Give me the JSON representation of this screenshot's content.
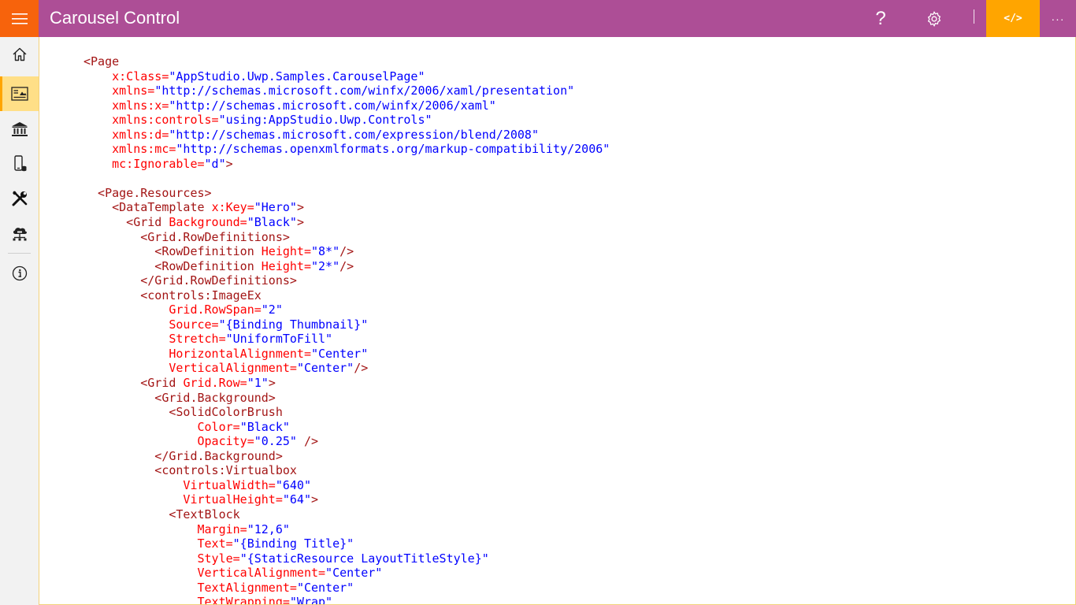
{
  "app": {
    "title": "Carousel Control"
  },
  "titlebar": {
    "menu_icon": "hamburger-icon",
    "help_label": "?",
    "settings_icon": "gear-icon",
    "code_button_label": "</>",
    "more_label": "···",
    "colors": {
      "bar": "#ad4e96",
      "hamburger": "#f7630c",
      "code_button": "#ffa500"
    }
  },
  "sidebar": {
    "items": [
      {
        "icon": "home-icon",
        "selected": false
      },
      {
        "icon": "gallery-icon",
        "selected": true
      },
      {
        "icon": "bank-icon",
        "selected": false
      },
      {
        "icon": "mobile-device-icon",
        "selected": false
      },
      {
        "icon": "tools-icon",
        "selected": false
      },
      {
        "icon": "cloud-network-icon",
        "selected": false
      },
      {
        "icon": "info-icon",
        "selected": false
      }
    ],
    "colors": {
      "background": "#f2f2f2",
      "selected": "#ffdf87"
    }
  },
  "code": {
    "language": "XAML",
    "colors": {
      "tag": "#a31515",
      "attribute": "#ff0000",
      "value": "#0000ff"
    },
    "lines": [
      [
        {
          "k": "tag",
          "t": "<Page"
        }
      ],
      [
        {
          "k": "attr",
          "t": "    x:Class="
        },
        {
          "k": "val",
          "t": "\"AppStudio.Uwp.Samples.CarouselPage\""
        }
      ],
      [
        {
          "k": "attr",
          "t": "    xmlns="
        },
        {
          "k": "val",
          "t": "\"http://schemas.microsoft.com/winfx/2006/xaml/presentation\""
        }
      ],
      [
        {
          "k": "attr",
          "t": "    xmlns:x="
        },
        {
          "k": "val",
          "t": "\"http://schemas.microsoft.com/winfx/2006/xaml\""
        }
      ],
      [
        {
          "k": "attr",
          "t": "    xmlns:controls="
        },
        {
          "k": "val",
          "t": "\"using:AppStudio.Uwp.Controls\""
        }
      ],
      [
        {
          "k": "attr",
          "t": "    xmlns:d="
        },
        {
          "k": "val",
          "t": "\"http://schemas.microsoft.com/expression/blend/2008\""
        }
      ],
      [
        {
          "k": "attr",
          "t": "    xmlns:mc="
        },
        {
          "k": "val",
          "t": "\"http://schemas.openxmlformats.org/markup-compatibility/2006\""
        }
      ],
      [
        {
          "k": "attr",
          "t": "    mc:Ignorable="
        },
        {
          "k": "val",
          "t": "\"d\""
        },
        {
          "k": "tag",
          "t": ">"
        }
      ],
      [],
      [
        {
          "k": "tag",
          "t": "  <Page.Resources>"
        }
      ],
      [
        {
          "k": "tag",
          "t": "    <DataTemplate "
        },
        {
          "k": "attr",
          "t": "x:Key="
        },
        {
          "k": "val",
          "t": "\"Hero\""
        },
        {
          "k": "tag",
          "t": ">"
        }
      ],
      [
        {
          "k": "tag",
          "t": "      <Grid "
        },
        {
          "k": "attr",
          "t": "Background="
        },
        {
          "k": "val",
          "t": "\"Black\""
        },
        {
          "k": "tag",
          "t": ">"
        }
      ],
      [
        {
          "k": "tag",
          "t": "        <Grid.RowDefinitions>"
        }
      ],
      [
        {
          "k": "tag",
          "t": "          <RowDefinition "
        },
        {
          "k": "attr",
          "t": "Height="
        },
        {
          "k": "val",
          "t": "\"8*\""
        },
        {
          "k": "tag",
          "t": "/>"
        }
      ],
      [
        {
          "k": "tag",
          "t": "          <RowDefinition "
        },
        {
          "k": "attr",
          "t": "Height="
        },
        {
          "k": "val",
          "t": "\"2*\""
        },
        {
          "k": "tag",
          "t": "/>"
        }
      ],
      [
        {
          "k": "tag",
          "t": "        </Grid.RowDefinitions>"
        }
      ],
      [
        {
          "k": "tag",
          "t": "        <controls:ImageEx"
        }
      ],
      [
        {
          "k": "attr",
          "t": "            Grid.RowSpan="
        },
        {
          "k": "val",
          "t": "\"2\""
        }
      ],
      [
        {
          "k": "attr",
          "t": "            Source="
        },
        {
          "k": "val",
          "t": "\"{Binding Thumbnail}\""
        }
      ],
      [
        {
          "k": "attr",
          "t": "            Stretch="
        },
        {
          "k": "val",
          "t": "\"UniformToFill\""
        }
      ],
      [
        {
          "k": "attr",
          "t": "            HorizontalAlignment="
        },
        {
          "k": "val",
          "t": "\"Center\""
        }
      ],
      [
        {
          "k": "attr",
          "t": "            VerticalAlignment="
        },
        {
          "k": "val",
          "t": "\"Center\""
        },
        {
          "k": "tag",
          "t": "/>"
        }
      ],
      [
        {
          "k": "tag",
          "t": "        <Grid "
        },
        {
          "k": "attr",
          "t": "Grid.Row="
        },
        {
          "k": "val",
          "t": "\"1\""
        },
        {
          "k": "tag",
          "t": ">"
        }
      ],
      [
        {
          "k": "tag",
          "t": "          <Grid.Background>"
        }
      ],
      [
        {
          "k": "tag",
          "t": "            <SolidColorBrush"
        }
      ],
      [
        {
          "k": "attr",
          "t": "                Color="
        },
        {
          "k": "val",
          "t": "\"Black\""
        }
      ],
      [
        {
          "k": "attr",
          "t": "                Opacity="
        },
        {
          "k": "val",
          "t": "\"0.25\""
        },
        {
          "k": "tag",
          "t": " />"
        }
      ],
      [
        {
          "k": "tag",
          "t": "          </Grid.Background>"
        }
      ],
      [
        {
          "k": "tag",
          "t": "          <controls:Virtualbox"
        }
      ],
      [
        {
          "k": "attr",
          "t": "              VirtualWidth="
        },
        {
          "k": "val",
          "t": "\"640\""
        }
      ],
      [
        {
          "k": "attr",
          "t": "              VirtualHeight="
        },
        {
          "k": "val",
          "t": "\"64\""
        },
        {
          "k": "tag",
          "t": ">"
        }
      ],
      [
        {
          "k": "tag",
          "t": "            <TextBlock"
        }
      ],
      [
        {
          "k": "attr",
          "t": "                Margin="
        },
        {
          "k": "val",
          "t": "\"12,6\""
        }
      ],
      [
        {
          "k": "attr",
          "t": "                Text="
        },
        {
          "k": "val",
          "t": "\"{Binding Title}\""
        }
      ],
      [
        {
          "k": "attr",
          "t": "                Style="
        },
        {
          "k": "val",
          "t": "\"{StaticResource LayoutTitleStyle}\""
        }
      ],
      [
        {
          "k": "attr",
          "t": "                VerticalAlignment="
        },
        {
          "k": "val",
          "t": "\"Center\""
        }
      ],
      [
        {
          "k": "attr",
          "t": "                TextAlignment="
        },
        {
          "k": "val",
          "t": "\"Center\""
        }
      ],
      [
        {
          "k": "attr",
          "t": "                TextWrapping="
        },
        {
          "k": "val",
          "t": "\"Wrap\""
        }
      ]
    ]
  }
}
